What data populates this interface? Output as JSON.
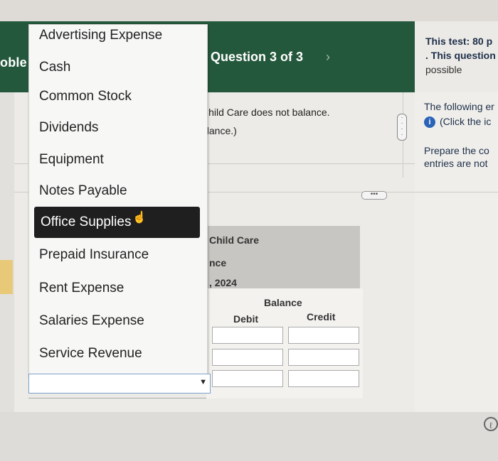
{
  "header": {
    "problem_label": "oble",
    "question_label": "Question 3 of 3",
    "next_arrow": "›"
  },
  "test_info": {
    "line1": "This test: 80 p",
    "line2": ". This question",
    "line3": "possible"
  },
  "prompt": {
    "line1": "Child Care does not balance.",
    "line2": "alance.)"
  },
  "right_panel": {
    "line1": "The following er",
    "line2": "(Click the ic",
    "line3": "Prepare the co",
    "line4": "entries are not"
  },
  "dropdown": {
    "options": [
      "Advertising Expense",
      "Cash",
      "Common Stock",
      "Dividends",
      "Equipment",
      "Notes Payable",
      "Office Supplies",
      "Prepaid Insurance",
      "Rent Expense",
      "Salaries Expense",
      "Service Revenue"
    ],
    "highlighted": "Office Supplies",
    "selected_value": ""
  },
  "trial_balance": {
    "company": "Child Care",
    "title_fragment": "nce",
    "date_fragment": ", 2024",
    "balance_label": "Balance",
    "debit_label": "Debit",
    "credit_label": "Credit"
  },
  "icons": {
    "info": "i",
    "clock": "ℓ"
  }
}
